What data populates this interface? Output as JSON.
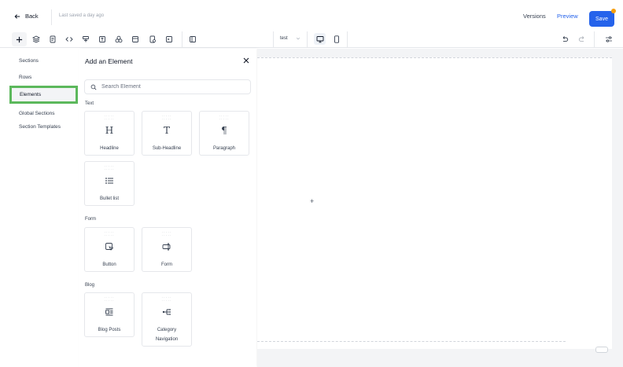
{
  "header": {
    "back_label": "Back",
    "saved_status": "Last saved a day ago",
    "versions_label": "Versions",
    "preview_label": "Preview",
    "save_label": "Save"
  },
  "toolbar": {
    "icons": [
      "plus-icon",
      "layers-icon",
      "page-icon",
      "code-icon",
      "funnel-icon",
      "text-box-icon",
      "shapes-icon",
      "layout-icon",
      "settings-doc-icon",
      "terminal-icon",
      "columns-icon"
    ],
    "device_select": "test",
    "undo_icon": "undo-icon",
    "redo_icon": "redo-icon",
    "settings_icon": "sliders-icon"
  },
  "leftnav": {
    "items": [
      {
        "label": "Sections"
      },
      {
        "label": "Rows"
      },
      {
        "label": "Elements"
      },
      {
        "label": "Global Sections"
      },
      {
        "label": "Section Templates"
      }
    ],
    "active": "Elements"
  },
  "panel": {
    "title": "Add an Element",
    "search_placeholder": "Search Element",
    "groups": [
      {
        "label": "Text",
        "items": [
          {
            "label": "Headline",
            "icon": "H"
          },
          {
            "label": "Sub-Headline",
            "icon": "T"
          },
          {
            "label": "Paragraph",
            "icon": "¶"
          },
          {
            "label": "Bullet list",
            "icon": "list-icon"
          }
        ]
      },
      {
        "label": "Form",
        "items": [
          {
            "label": "Button",
            "icon": "cursor-click-icon"
          },
          {
            "label": "Form",
            "icon": "input-field-icon"
          }
        ]
      },
      {
        "label": "Blog",
        "items": [
          {
            "label": "Blog Posts",
            "icon": "blog-posts-icon"
          },
          {
            "label": "Category Navigation",
            "icon": "category-tree-icon"
          }
        ]
      }
    ]
  },
  "canvas": {
    "add_symbol": "+"
  },
  "colors": {
    "accent": "#2563eb",
    "active_outline": "#5cb85c",
    "notify_dot": "#f59e0b"
  }
}
